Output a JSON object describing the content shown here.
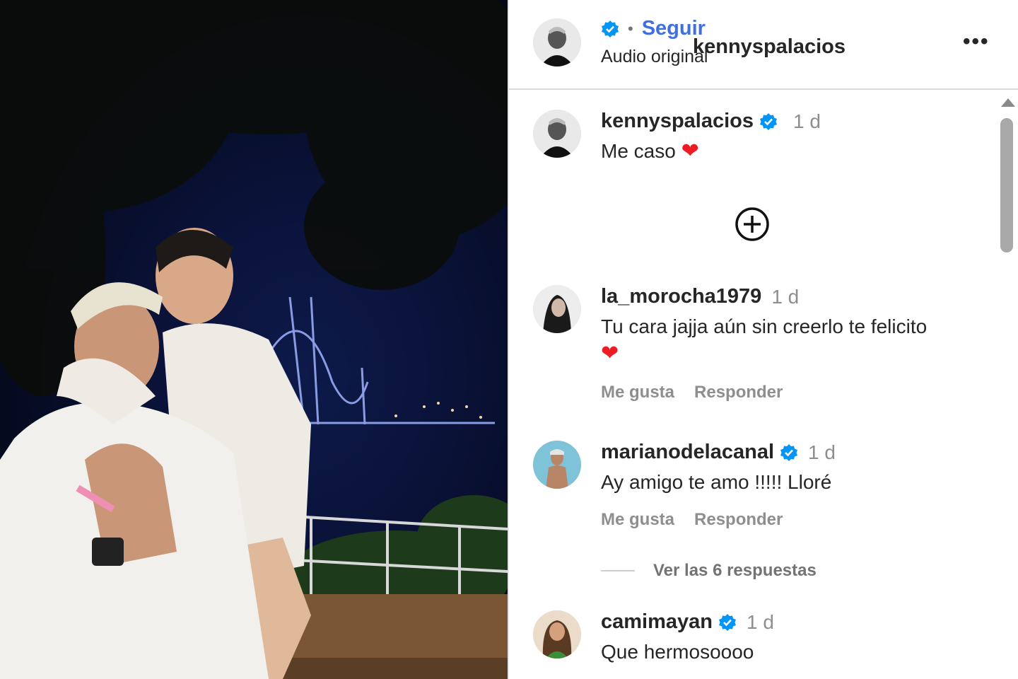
{
  "header": {
    "username": "kennyspalacios",
    "separator": "•",
    "follow_label": "Seguir",
    "subtitle": "Audio original",
    "more_label": "•••"
  },
  "icons": {
    "verified": "verified-badge-icon",
    "plus": "plus-circle-icon",
    "heart": "heart-icon",
    "more": "more-options-icon"
  },
  "colors": {
    "follow": "#3f6fe0",
    "verified": "#0095f6",
    "heart": "#ed1c24",
    "muted": "#8e8e8e"
  },
  "caption": {
    "username": "kennyspalacios",
    "time": "1 d",
    "text": "Me caso",
    "emoji": "❤"
  },
  "comments": [
    {
      "username": "la_morocha1979",
      "time": "1 d",
      "text": "Tu cara jajja aún sin creerlo te felicito",
      "emoji": "❤",
      "like_label": "Me gusta",
      "reply_label": "Responder"
    },
    {
      "username": "marianodelacanal",
      "time": "1 d",
      "text": "Ay amigo te amo !!!!! Lloré",
      "like_label": "Me gusta",
      "reply_label": "Responder",
      "view_replies": "Ver las 6 respuestas"
    },
    {
      "username": "camimayan",
      "time": "1 d",
      "text": "Que hermosoooo"
    }
  ]
}
